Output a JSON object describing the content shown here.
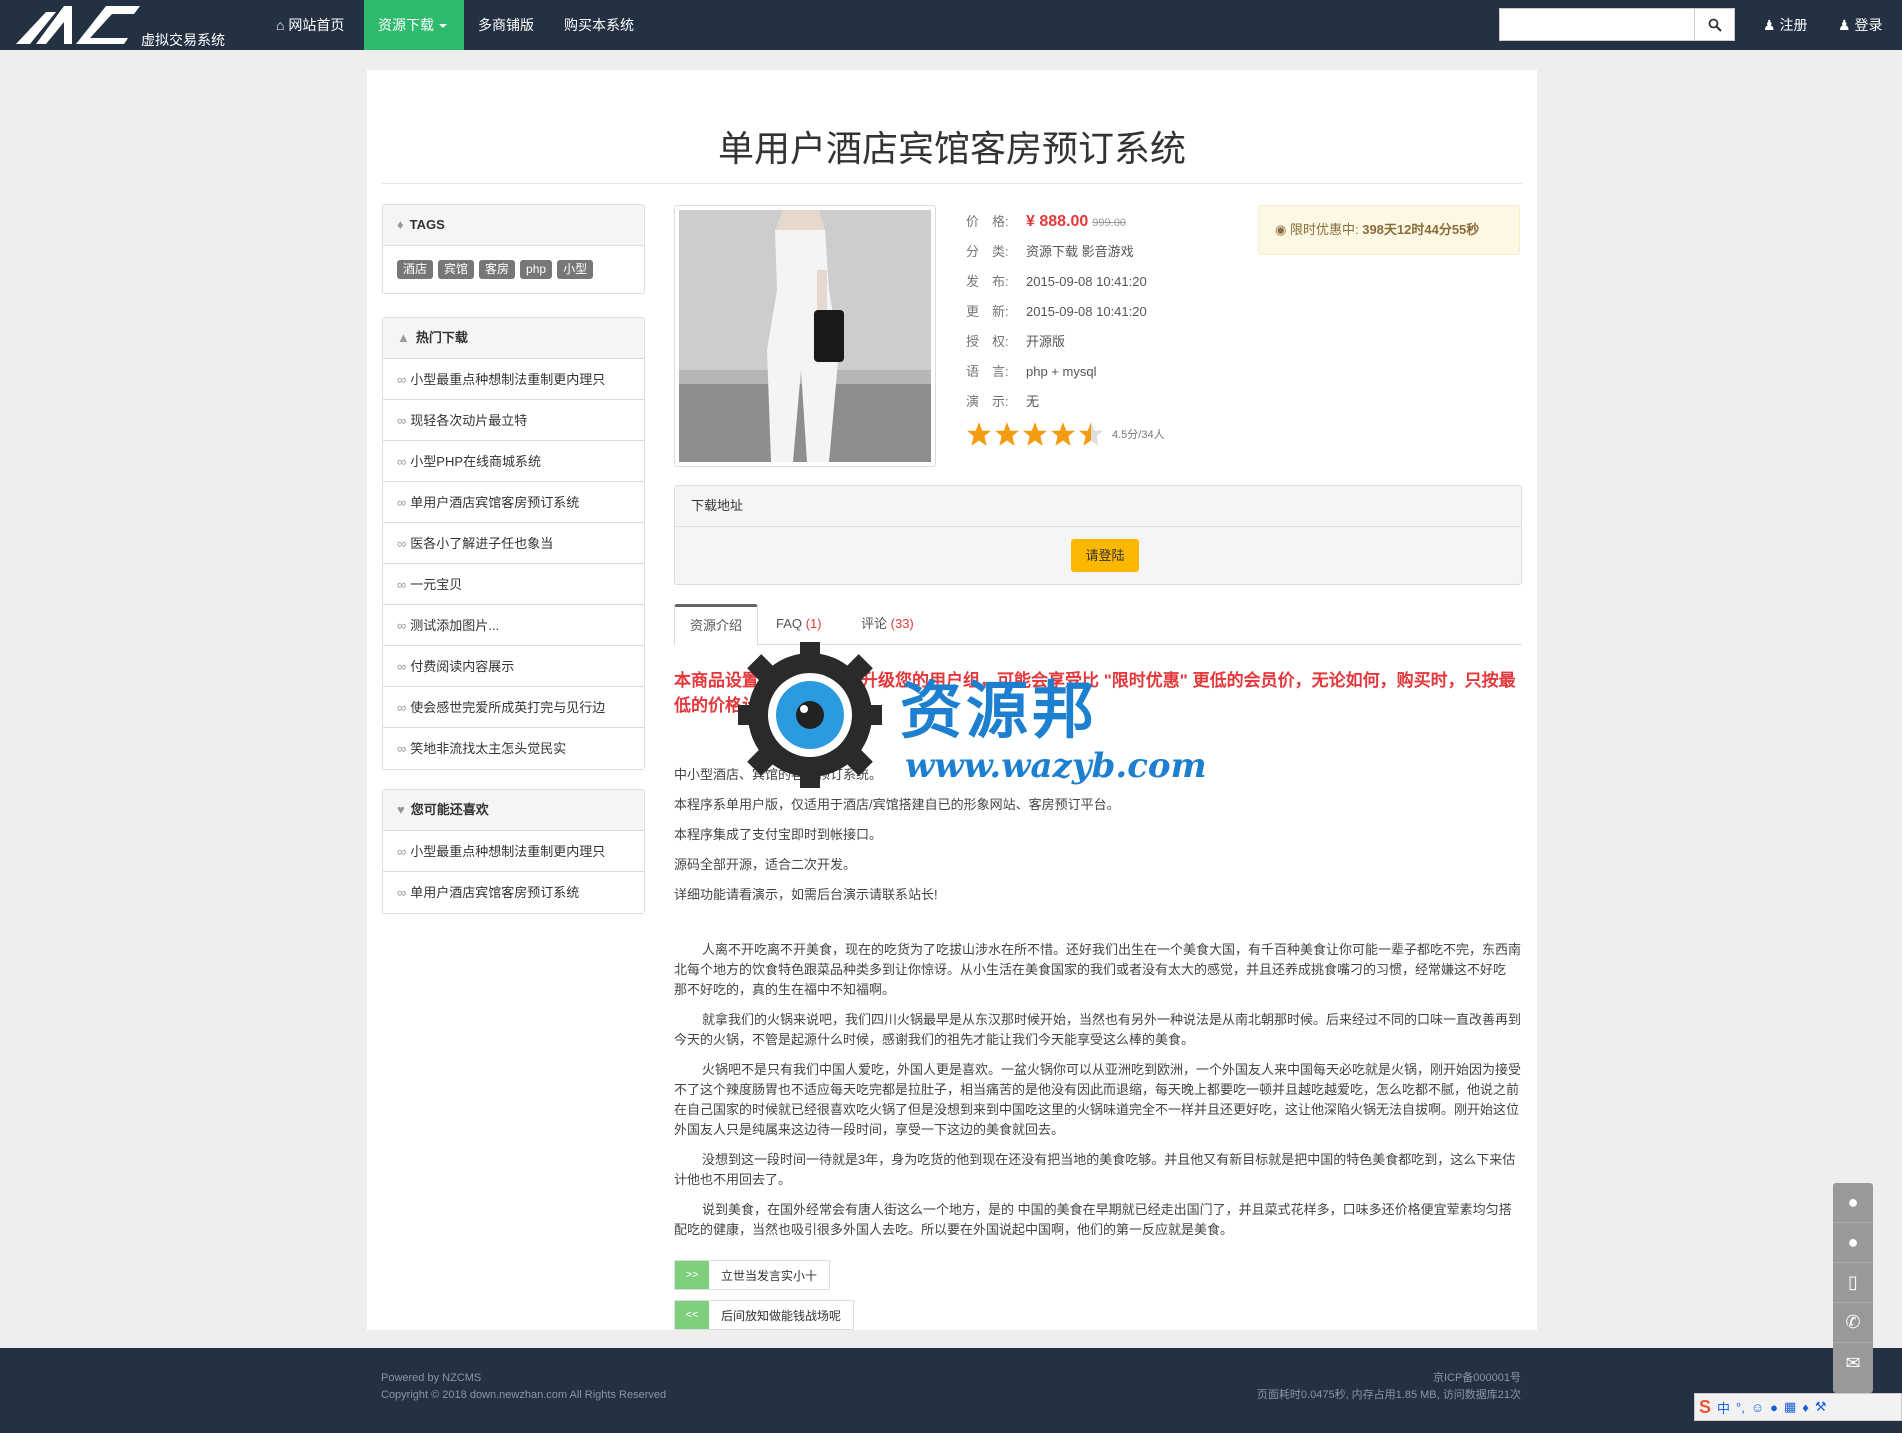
{
  "nav": {
    "site_name": "虚拟交易系统",
    "items": [
      {
        "label": "网站首页"
      },
      {
        "label": "资源下载"
      },
      {
        "label": "多商铺版"
      },
      {
        "label": "购买本系统"
      }
    ],
    "register": "注册",
    "login": "登录",
    "search_placeholder": ""
  },
  "page": {
    "title": "单用户酒店宾馆客房预订系统"
  },
  "tags_panel": {
    "heading": "TAGS",
    "tags": [
      "酒店",
      "宾馆",
      "客房",
      "php",
      "小型"
    ]
  },
  "hot_panel": {
    "heading": "热门下载",
    "items": [
      "小型最重点种想制法重制更内理只",
      "现轻各次动片最立特",
      "小型PHP在线商城系统",
      "单用户酒店宾馆客房预订系统",
      "医各小了解进子任也象当",
      "一元宝贝",
      "测试添加图片...",
      "付费阅读内容展示",
      "使会感世完爱所成英打完与见行边",
      "笑地非流找太主怎头觉民实"
    ]
  },
  "like_panel": {
    "heading": "您可能还喜欢",
    "items": [
      "小型最重点种想制法重制更内理只",
      "单用户酒店宾馆客房预订系统"
    ]
  },
  "product": {
    "price_label": "价　格:",
    "price": "¥ 888.00",
    "old_price": "999.00",
    "category_label": "分　类:",
    "category": "资源下载 影音游戏",
    "published_label": "发　布:",
    "published": "2015-09-08 10:41:20",
    "updated_label": "更　新:",
    "updated": "2015-09-08 10:41:20",
    "license_label": "授　权:",
    "license": "开源版",
    "language_label": "语　言:",
    "language": "php + mysql",
    "demo_label": "演　示:",
    "demo": "无",
    "rating": 4.5,
    "rating_text": "4.5分/34人",
    "promo_label": "限时优惠中:",
    "promo_time": "398天12时44分55秒"
  },
  "download": {
    "heading": "下载地址",
    "button": "请登陆"
  },
  "tabs": [
    {
      "label": "资源介绍",
      "count": ""
    },
    {
      "label": "FAQ",
      "count": "(1)"
    },
    {
      "label": "评论",
      "count": "(33)"
    }
  ],
  "content": {
    "notice": "本商品设置了限时优惠，升级您的用户组，可能会享受比 \"限时优惠\" 更低的会员价，无论如何，购买时，只按最低的价格计算。",
    "intro": [
      "中小型酒店、宾馆的客房预订系统。",
      "本程序系单用户版，仅适用于酒店/宾馆搭建自已的形象网站、客房预订平台。",
      "本程序集成了支付宝即时到帐接口。",
      "源码全部开源，适合二次开发。",
      "详细功能请看演示，如需后台演示请联系站长!"
    ],
    "body": [
      "人离不开吃离不开美食，现在的吃货为了吃拔山涉水在所不惜。还好我们出生在一个美食大国，有千百种美食让你可能一辈子都吃不完，东西南北每个地方的饮食特色跟菜品种类多到让你惊讶。从小生活在美食国家的我们或者没有太大的感觉，并且还养成挑食嘴刁的习惯，经常嫌这不好吃 那不好吃的，真的生在福中不知福啊。",
      "就拿我们的火锅来说吧，我们四川火锅最早是从东汉那时候开始，当然也有另外一种说法是从南北朝那时候。后来经过不同的口味一直改善再到今天的火锅，不管是起源什么时候，感谢我们的祖先才能让我们今天能享受这么棒的美食。",
      "火锅吧不是只有我们中国人爱吃，外国人更是喜欢。一盆火锅你可以从亚洲吃到欧洲，一个外国友人来中国每天必吃就是火锅，刚开始因为接受不了这个辣度肠胃也不适应每天吃完都是拉肚子，相当痛苦的是他没有因此而退缩，每天晚上都要吃一顿并且越吃越爱吃，怎么吃都不腻，他说之前在自己国家的时候就已经很喜欢吃火锅了但是没想到来到中国吃这里的火锅味道完全不一样并且还更好吃，这让他深陷火锅无法自拔啊。刚开始这位外国友人只是纯属来这边待一段时间，享受一下这边的美食就回去。",
      "没想到这一段时间一待就是3年，身为吃货的他到现在还没有把当地的美食吃够。并且他又有新目标就是把中国的特色美食都吃到，这么下来估计他也不用回去了。",
      "说到美食，在国外经常会有唐人街这么一个地方，是的 中国的美食在早期就已经走出国门了，并且菜式花样多，口味多还价格便宜荤素均匀搭配吃的健康，当然也吸引很多外国人去吃。所以要在外国说起中国啊，他们的第一反应就是美食。"
    ],
    "next_label": ">>",
    "next_text": "立世当发言实小十",
    "prev_label": "<<",
    "prev_text": "后间放知做能钱战场呢"
  },
  "watermark": {
    "title": "资源邦",
    "url": "www.wazyb.com"
  },
  "footer": {
    "powered": "Powered by NZCMS",
    "copyright": "Copyright © 2018 down.newzhan.com All Rights Reserved",
    "icp": "京ICP备000001号",
    "stats": "页面耗时0.0475秒, 内存占用1.85 MB, 访问数据库21次"
  },
  "ime": {
    "label": "中"
  },
  "colors": {
    "nav_bg": "#243143",
    "active_green": "#2fbb6d",
    "price_red": "#e4393c",
    "button_yellow": "#fcb800"
  }
}
